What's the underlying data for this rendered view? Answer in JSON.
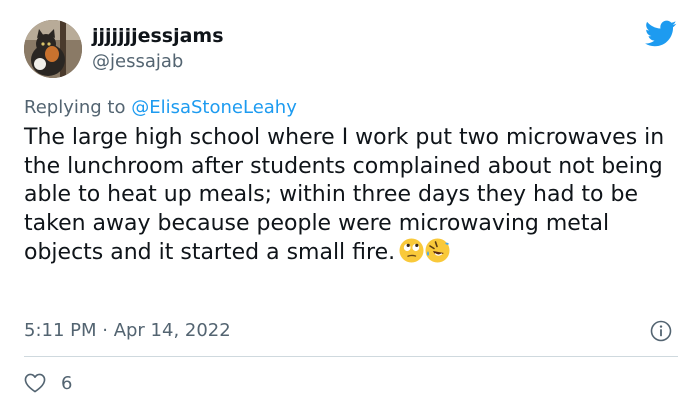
{
  "author": {
    "display_name": "jjjjjjjessjams",
    "handle": "@jessajab",
    "avatar": "cat-photo-avatar"
  },
  "platform_icon": "twitter-bird-icon",
  "reply": {
    "prefix": "Replying to",
    "mention": "@ElisaStoneLeahy"
  },
  "tweet": {
    "text": "The large high school where I work put two microwaves in the lunchroom after students complained about not being able to heat up meals; within three days they had to be taken away because people were microwaving metal objects and it started a small fire.",
    "emojis": [
      "face-with-rolling-eyes-emoji",
      "rolling-on-the-floor-laughing-emoji"
    ]
  },
  "meta": {
    "timestamp": "5:11 PM · Apr 14, 2022",
    "info_icon": "info-icon"
  },
  "stats": {
    "like_icon": "heart-icon",
    "likes": "6"
  },
  "colors": {
    "accent": "#1d9bf0",
    "text": "#0f1419",
    "secondary": "#536471",
    "divider": "#cfd9de"
  }
}
